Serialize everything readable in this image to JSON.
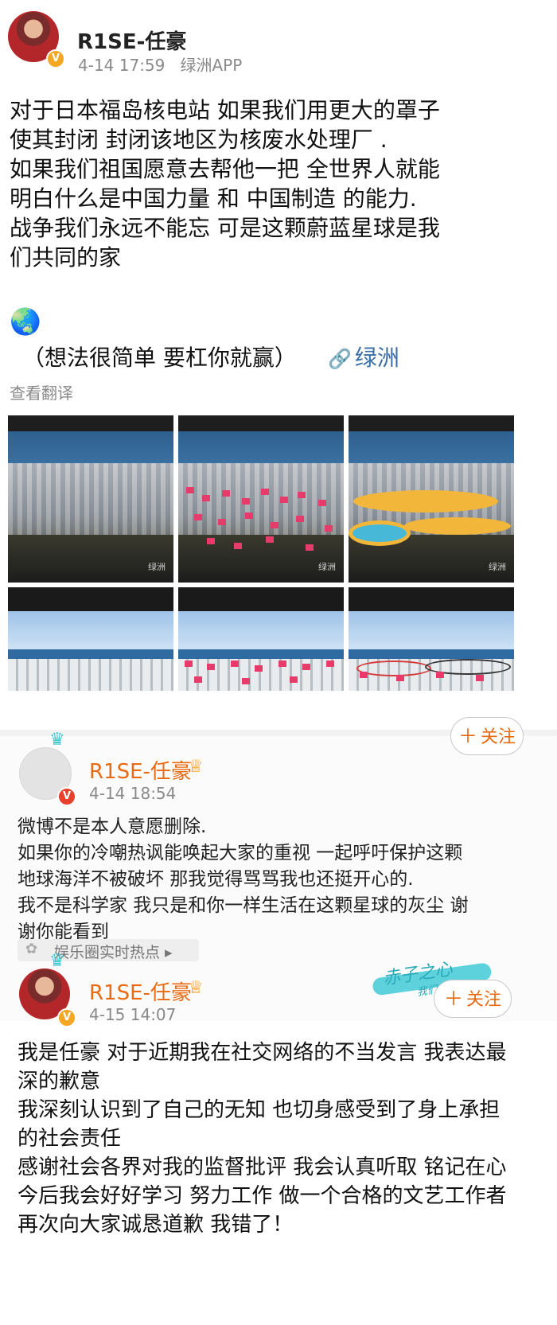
{
  "post1": {
    "username": "R1SE-任豪",
    "timestamp": "4-14 17:59",
    "source": "绿洲APP",
    "lines": [
      "对于日本福岛核电站 如果我们用更大的罩子",
      "使其封闭 封闭该地区为核废水处理厂 .",
      "如果我们祖国愿意去帮他一把 全世界人就能",
      "明白什么是中国力量 和 中国制造 的能力.",
      "战争我们永远不能忘 可是这颗蔚蓝星球是我",
      "们共同的家"
    ],
    "earth_emoji": "🌏",
    "extra": "（想法很简单 要杠你就赢）",
    "oasis_link": "绿洲",
    "translate": "查看翻译",
    "image_watermark": "绿洲"
  },
  "post2": {
    "username": "R1SE-任豪",
    "timestamp": "4-14 18:54",
    "follow_label": "关注",
    "lines": [
      "微博不是本人意愿删除.",
      "如果你的冷嘲热讽能唤起大家的重视 一起呼吁保护这颗",
      "地球海洋不被破坏 那我觉得骂骂我也还挺开心的.",
      "我不是科学家 我只是和你一样生活在这颗星球的灰尘 谢",
      "谢你能看到"
    ],
    "topic_label": "娱乐圈实时热点 ▸"
  },
  "post3": {
    "username": "R1SE-任豪",
    "timestamp": "4-15 14:07",
    "follow_label": "关注",
    "lines": [
      "我是任豪 对于近期我在社交网络的不当发言 我表达最",
      "深的歉意",
      "我深刻认识到了自己的无知 也切身感受到了身上承担",
      "的社会责任",
      "感谢社会各界对我的监督批评 我会认真听取 铭记在心",
      "今后我会好好学习 努力工作 做一个合格的文艺工作者",
      "再次向大家诚恳道歉 我错了！"
    ],
    "sticker_text": "赤子之心",
    "sticker_sub": "我们来继续"
  },
  "colors": {
    "accent": "#e86a12",
    "link": "#3b6ea5",
    "verified": "#f5a623",
    "sticker": "#41c9d6"
  },
  "icons": [
    "verified-badge-icon",
    "crown-icon",
    "link-icon",
    "plus-icon",
    "topic-icon",
    "earth-emoji"
  ]
}
